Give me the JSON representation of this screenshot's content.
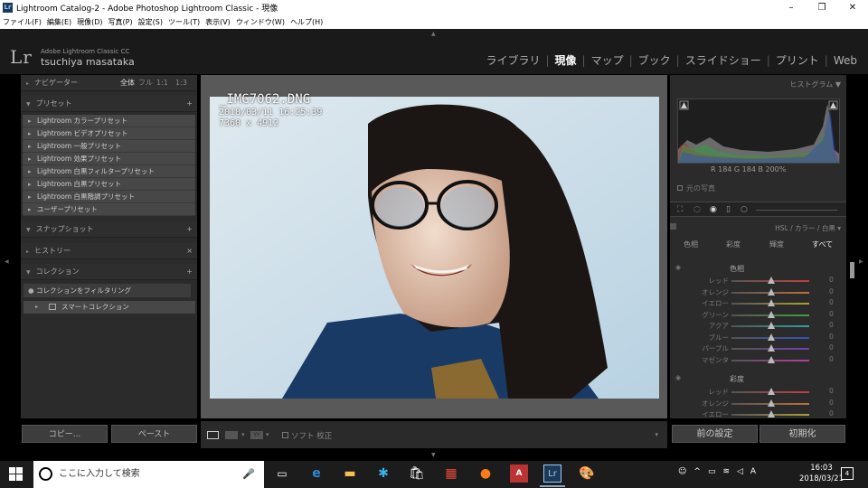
{
  "window": {
    "title": "Lightroom Catalog-2 - Adobe Photoshop Lightroom Classic - 現像",
    "app_icon": "Lr"
  },
  "menu": [
    "ファイル(F)",
    "編集(E)",
    "現像(D)",
    "写真(P)",
    "設定(S)",
    "ツール(T)",
    "表示(V)",
    "ウィンドウ(W)",
    "ヘルプ(H)"
  ],
  "identity": {
    "logo": "Lr",
    "product": "Adobe Lightroom Classic CC",
    "user": "tsuchiya masataka"
  },
  "modules": [
    {
      "label": "ライブラリ",
      "active": false
    },
    {
      "label": "現像",
      "active": true
    },
    {
      "label": "マップ",
      "active": false
    },
    {
      "label": "ブック",
      "active": false
    },
    {
      "label": "スライドショー",
      "active": false
    },
    {
      "label": "プリント",
      "active": false
    },
    {
      "label": "Web",
      "active": false
    }
  ],
  "left": {
    "navigator": {
      "title": "ナビゲーター",
      "zoom": [
        "全体",
        "フル",
        "1:1",
        "1:3"
      ]
    },
    "presets": {
      "title": "プリセット",
      "items": [
        "Lightroom カラープリセット",
        "Lightroom ビデオプリセット",
        "Lightroom 一般プリセット",
        "Lightroom 効果プリセット",
        "Lightroom 白黒フィルタープリセット",
        "Lightroom 白黒プリセット",
        "Lightroom 白黒階調プリセット",
        "ユーザープリセット"
      ]
    },
    "snapshot": "スナップショット",
    "history": "ヒストリー",
    "collections": {
      "title": "コレクション",
      "filter": "コレクションをフィルタリング",
      "smart": "スマートコレクション"
    },
    "copy": "コピー...",
    "paste": "ペースト"
  },
  "photo": {
    "filename": "_IMG7062.DNG",
    "datetime": "2018/03/11 16:25:39",
    "dimensions": "7360 x 4912"
  },
  "toolbar": {
    "soft_proof": "ソフト 校正"
  },
  "right": {
    "histogram": {
      "title": "ヒストグラム",
      "readout": "R 184 G 184 B 200%",
      "original": "元の写真"
    },
    "hsl": {
      "title": "HSL / カラー / 白黒 ▾",
      "tabs": [
        "色相",
        "彩度",
        "輝度",
        "すべて"
      ]
    },
    "hue_title": "色相",
    "hue_rows": [
      {
        "label": "レッド",
        "value": "0",
        "color": "#c04040"
      },
      {
        "label": "オレンジ",
        "value": "0",
        "color": "#c07030"
      },
      {
        "label": "イエロー",
        "value": "0",
        "color": "#b0a030"
      },
      {
        "label": "グリーン",
        "value": "0",
        "color": "#40a040"
      },
      {
        "label": "アクア",
        "value": "0",
        "color": "#30a0a0"
      },
      {
        "label": "ブルー",
        "value": "0",
        "color": "#3050c0"
      },
      {
        "label": "パープル",
        "value": "0",
        "color": "#7040b0"
      },
      {
        "label": "マゼンタ",
        "value": "0",
        "color": "#b040a0"
      }
    ],
    "sat_title": "彩度",
    "sat_rows": [
      {
        "label": "レッド",
        "value": "0",
        "color": "#c04040"
      },
      {
        "label": "オレンジ",
        "value": "0",
        "color": "#c07030"
      },
      {
        "label": "イエロー",
        "value": "0",
        "color": "#b0a030"
      }
    ],
    "prev": "前の設定",
    "reset": "初期化"
  },
  "taskbar": {
    "search": "ここに入力して検索",
    "time": "16:03",
    "date": "2018/03/21",
    "notif": "4"
  }
}
